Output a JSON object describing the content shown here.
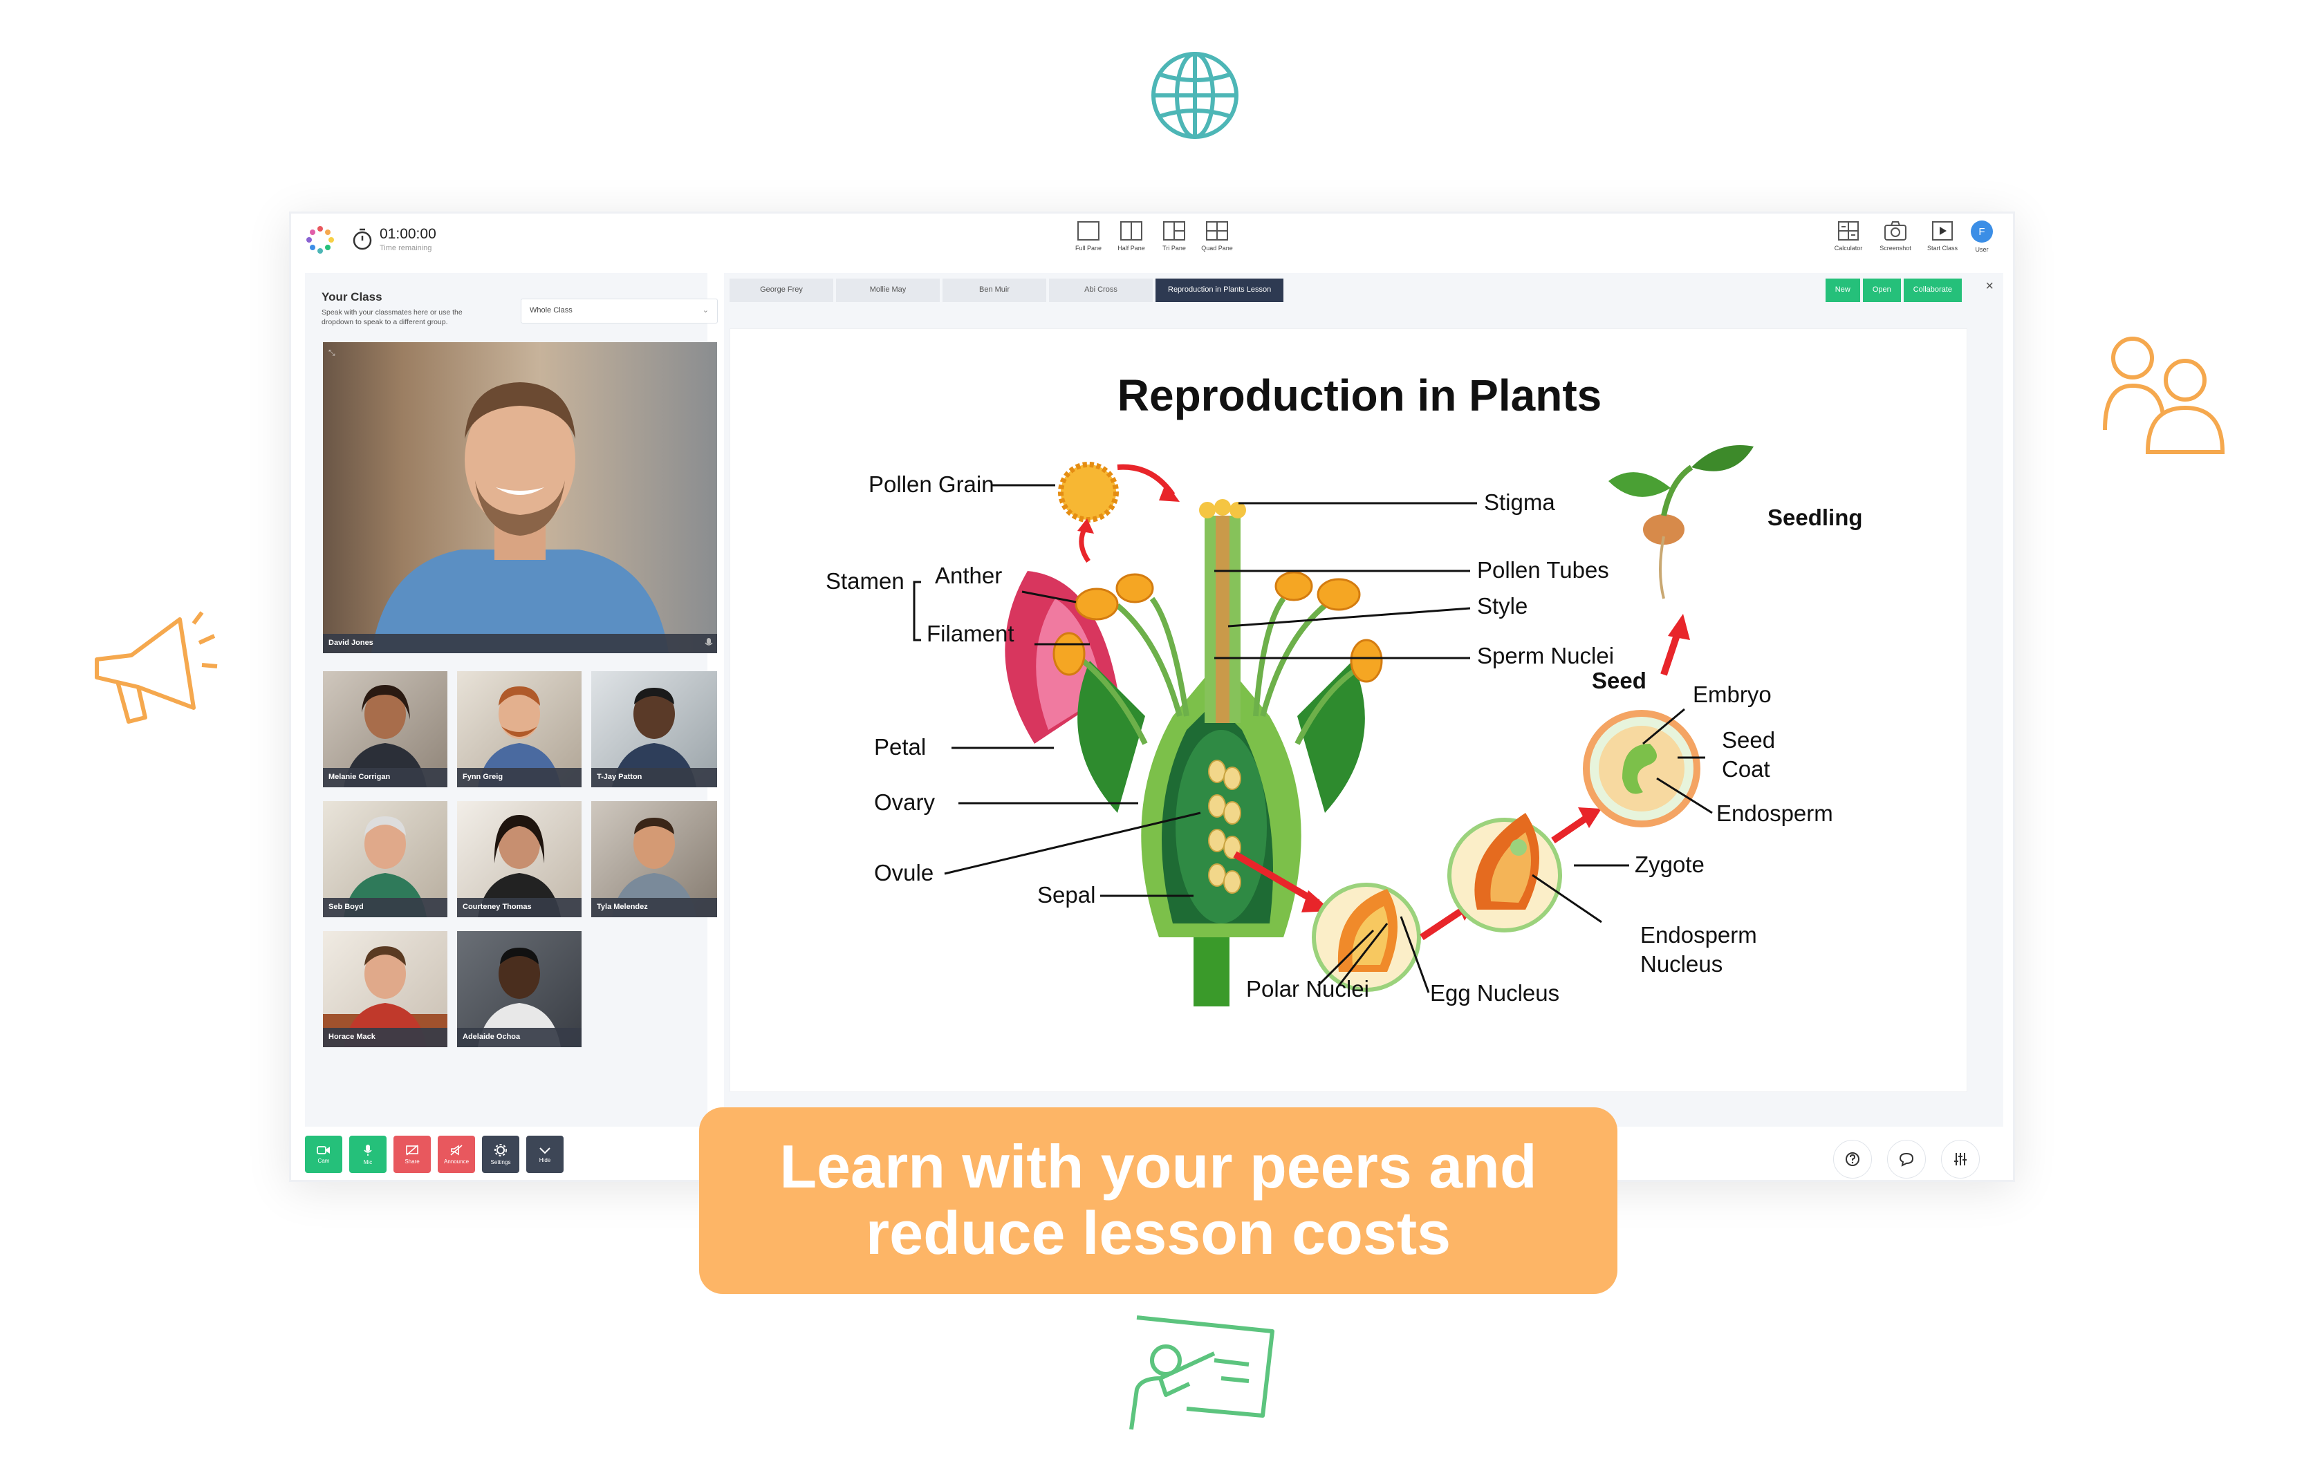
{
  "timer": {
    "value": "01:00:00",
    "label": "Time remaining"
  },
  "pane_tools": [
    "Full Pane",
    "Half Pane",
    "Tri Pane",
    "Quad Pane"
  ],
  "right_tools": [
    "Calculator",
    "Screenshot",
    "Start Class"
  ],
  "user": {
    "initial": "F",
    "label": "User"
  },
  "your_class": {
    "title": "Your Class",
    "description": "Speak with your classmates here or use the dropdown to speak to a different group.",
    "group_select": "Whole Class"
  },
  "participants": {
    "main": "David Jones",
    "grid": [
      "Melanie Corrigan",
      "Fynn Greig",
      "T-Jay Patton",
      "Seb Boyd",
      "Courteney Thomas",
      "Tyla Melendez",
      "Horace Mack",
      "Adelaide Ochoa"
    ]
  },
  "tabs": [
    "George Frey",
    "Mollie May",
    "Ben Muir",
    "Abi Cross",
    "Reproduction in Plants Lesson"
  ],
  "actions": [
    "New",
    "Open",
    "Collaborate"
  ],
  "diagram": {
    "title": "Reproduction in Plants",
    "labels": {
      "pollen_grain": "Pollen Grain",
      "stamen": "Stamen",
      "anther": "Anther",
      "filament": "Filament",
      "stigma": "Stigma",
      "pollen_tubes": "Pollen Tubes",
      "style": "Style",
      "sperm_nuclei": "Sperm Nuclei",
      "petal": "Petal",
      "ovary": "Ovary",
      "ovule": "Ovule",
      "sepal": "Sepal",
      "polar_nuclei": "Polar Nuclei",
      "egg_nucleus": "Egg Nucleus",
      "endosperm_nucleus_1": "Endosperm",
      "endosperm_nucleus_2": "Nucleus",
      "zygote": "Zygote",
      "seed": "Seed",
      "embryo": "Embryo",
      "seed_coat_1": "Seed",
      "seed_coat_2": "Coat",
      "endosperm": "Endosperm",
      "seedling": "Seedling"
    }
  },
  "controls": [
    "Cam",
    "Mic",
    "Share",
    "Announce",
    "Settings",
    "Hide"
  ],
  "banner": {
    "line1": "Learn with your peers and",
    "line2": "reduce lesson costs"
  },
  "colors": {
    "green": "#25c07a",
    "red": "#e8585e",
    "dark": "#3d4656",
    "orange": "#fdb566",
    "teal": "#4db6b6"
  }
}
